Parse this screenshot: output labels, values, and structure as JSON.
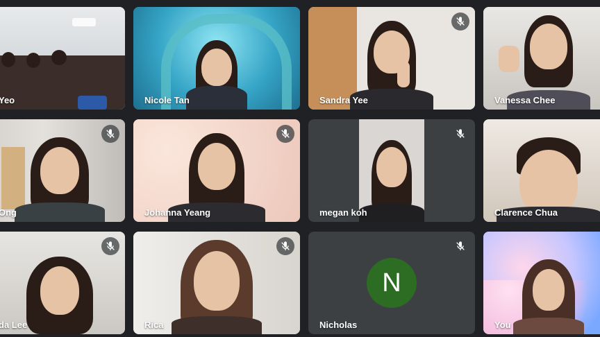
{
  "tiles": [
    {
      "name": "Yeo",
      "muted": false
    },
    {
      "name": "Nicole Tan",
      "muted": false
    },
    {
      "name": "Sandra Yee",
      "muted": true
    },
    {
      "name": "Vanessa Chee",
      "muted": false
    },
    {
      "name": "Ong",
      "muted": true
    },
    {
      "name": "Johanna Yeang",
      "muted": true
    },
    {
      "name": "megan koh",
      "muted": true
    },
    {
      "name": "Clarence Chua",
      "muted": false
    },
    {
      "name": "da Lee",
      "muted": true
    },
    {
      "name": "Rica",
      "muted": true
    },
    {
      "name": "Nicholas",
      "muted": true,
      "avatar_letter": "N"
    },
    {
      "name": "You",
      "muted": false
    }
  ],
  "colors": {
    "background": "#202124",
    "tile": "#3c4043",
    "avatar": "#2d6d23",
    "self_highlight": "#8ab4f8"
  },
  "icons": {
    "muted": "mic-off-icon"
  }
}
